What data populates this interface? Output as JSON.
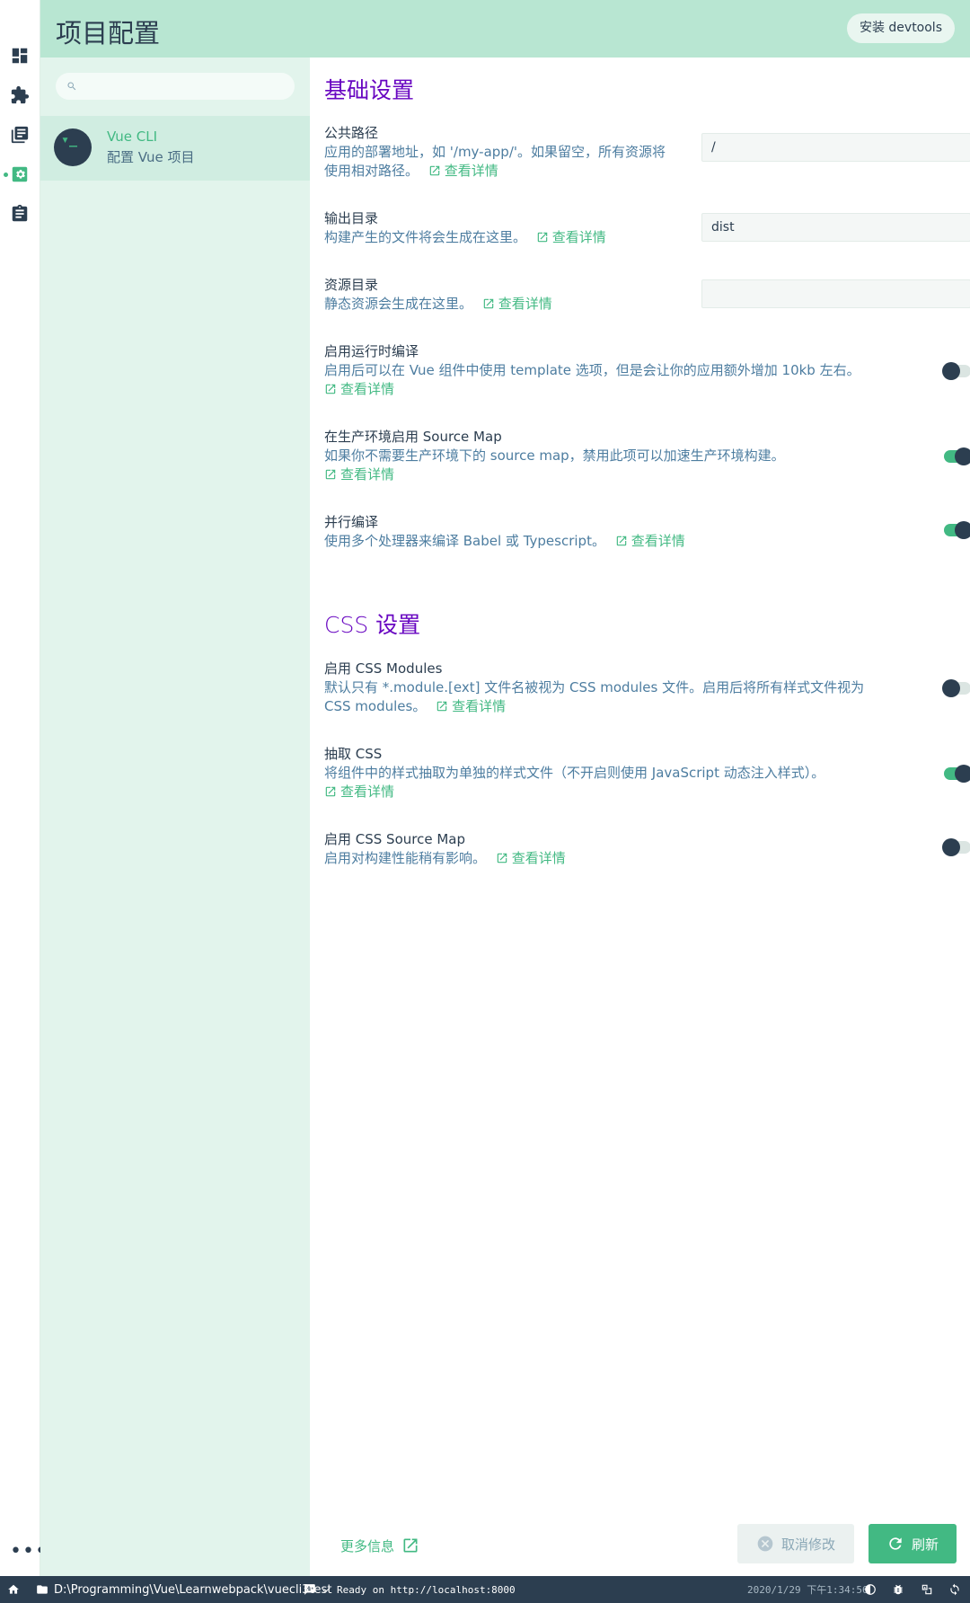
{
  "header": {
    "title": "项目配置",
    "devtools_label": "安装 devtools"
  },
  "sidebar": {
    "search_placeholder": "",
    "project": {
      "avatar_glyph": "▾_",
      "name": "Vue CLI",
      "description": "配置 Vue 项目"
    }
  },
  "rail": {
    "icons": [
      "dashboard-icon",
      "puzzle-icon",
      "library-icon",
      "config-icon",
      "clipboard-icon"
    ],
    "more": "•••"
  },
  "sections": {
    "basic": {
      "title": "基础设置"
    },
    "css": {
      "title_prefix": "CSS",
      "title_suffix": " 设置"
    }
  },
  "prompts": {
    "publicPath": {
      "label": "公共路径",
      "desc": "应用的部署地址，如 '/my-app/'。如果留空，所有资源将使用相对路径。",
      "value": "/"
    },
    "outputDir": {
      "label": "输出目录",
      "desc": "构建产生的文件将会生成在这里。",
      "value": "dist"
    },
    "assetsDir": {
      "label": "资源目录",
      "desc": "静态资源会生成在这里。",
      "value": ""
    },
    "runtimeCompiler": {
      "label": "启用运行时编译",
      "desc": "启用后可以在 Vue 组件中使用 template 选项，但是会让你的应用额外增加 10kb 左右。",
      "enabled": false
    },
    "sourceMap": {
      "label": "在生产环境启用 Source Map",
      "desc": "如果你不需要生产环境下的 source map，禁用此项可以加速生产环境构建。",
      "enabled": true
    },
    "parallel": {
      "label": "并行编译",
      "desc": "使用多个处理器来编译 Babel 或 Typescript。",
      "enabled": true
    },
    "cssModules": {
      "label": "启用 CSS Modules",
      "desc": "默认只有 *.module.[ext] 文件名被视为 CSS modules 文件。启用后将所有样式文件视为 CSS modules。",
      "enabled": false
    },
    "extractCss": {
      "label": "抽取 CSS",
      "desc": "将组件中的样式抽取为单独的样式文件（不开启则使用 JavaScript 动态注入样式）。",
      "enabled": true
    },
    "cssSourceMap": {
      "label": "启用 CSS Source Map",
      "desc": "启用对构建性能稍有影响。",
      "enabled": false
    }
  },
  "more_label": "查看详情",
  "footer": {
    "more_info": "更多信息",
    "cancel": "取消修改",
    "refresh": "刷新"
  },
  "statusbar": {
    "path": "D:\\Programming\\Vue\\Learnwebpack\\vuecli3test",
    "log": "Ready on http://localhost:8000",
    "datetime": "2020/1/29 下午1:34:56"
  },
  "colors": {
    "accent": "#42b983",
    "dark": "#2c3e50",
    "header": "#b8e6d2",
    "sidebar": "#e2f4ec",
    "section_title": "#6806c1"
  }
}
